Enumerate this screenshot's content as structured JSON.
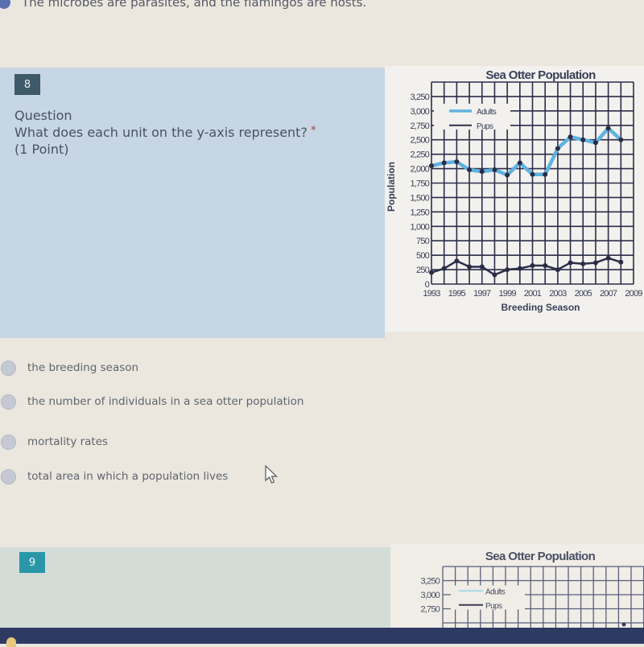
{
  "previous_question": {
    "visible_answer": "The microbes are parasites, and the flamingos are hosts."
  },
  "question8": {
    "number": "8",
    "label": "Question",
    "text": "What does each unit on the y-axis represent?",
    "required_marker": "*",
    "points": "(1 Point)",
    "options": [
      {
        "label": "the breeding season",
        "selected": false
      },
      {
        "label": "the number of individuals in a sea otter population",
        "selected": false
      },
      {
        "label": "mortality rates",
        "selected": false
      },
      {
        "label": "total area in which a population lives",
        "selected": false
      }
    ]
  },
  "question9": {
    "number": "9",
    "chart_title": "Sea Otter Population",
    "visible_yticks": [
      "3,250",
      "3,000",
      "2,750"
    ],
    "legend": [
      "Adults",
      "Pups"
    ]
  },
  "colors": {
    "adults": "#5fb2e0",
    "pups": "#2c2f48",
    "grid": "#2b2d4a",
    "question_card": "#c6d6e4",
    "q8_badge": "#3e5a68",
    "q9_badge": "#2a97a8",
    "required": "#c0392b"
  },
  "chart_data": {
    "type": "line",
    "title": "Sea Otter Population",
    "xlabel": "Breeding Season",
    "ylabel": "Population",
    "x": [
      1993,
      1994,
      1995,
      1996,
      1997,
      1998,
      1999,
      2000,
      2001,
      2002,
      2003,
      2004,
      2005,
      2006,
      2007,
      2008
    ],
    "xlim": [
      1993,
      2009
    ],
    "xtick_labels": [
      "1993",
      "1995",
      "1997",
      "1999",
      "2001",
      "2003",
      "2005",
      "2007",
      "2009"
    ],
    "ylim": [
      0,
      3250
    ],
    "ytick_labels": [
      "0",
      "250",
      "500",
      "750",
      "1,000",
      "1,250",
      "1,500",
      "1,750",
      "2,000",
      "2,250",
      "2,500",
      "2,750",
      "3,000",
      "3,250"
    ],
    "grid": true,
    "legend_position": "top-left",
    "series": [
      {
        "name": "Adults",
        "values": [
          2050,
          2100,
          2120,
          1980,
          1950,
          1980,
          1890,
          2100,
          1900,
          1900,
          2350,
          2550,
          2500,
          2450,
          2700,
          2500
        ]
      },
      {
        "name": "Pups",
        "values": [
          200,
          270,
          400,
          300,
          300,
          160,
          250,
          270,
          320,
          320,
          250,
          370,
          350,
          370,
          450,
          380
        ]
      }
    ]
  }
}
